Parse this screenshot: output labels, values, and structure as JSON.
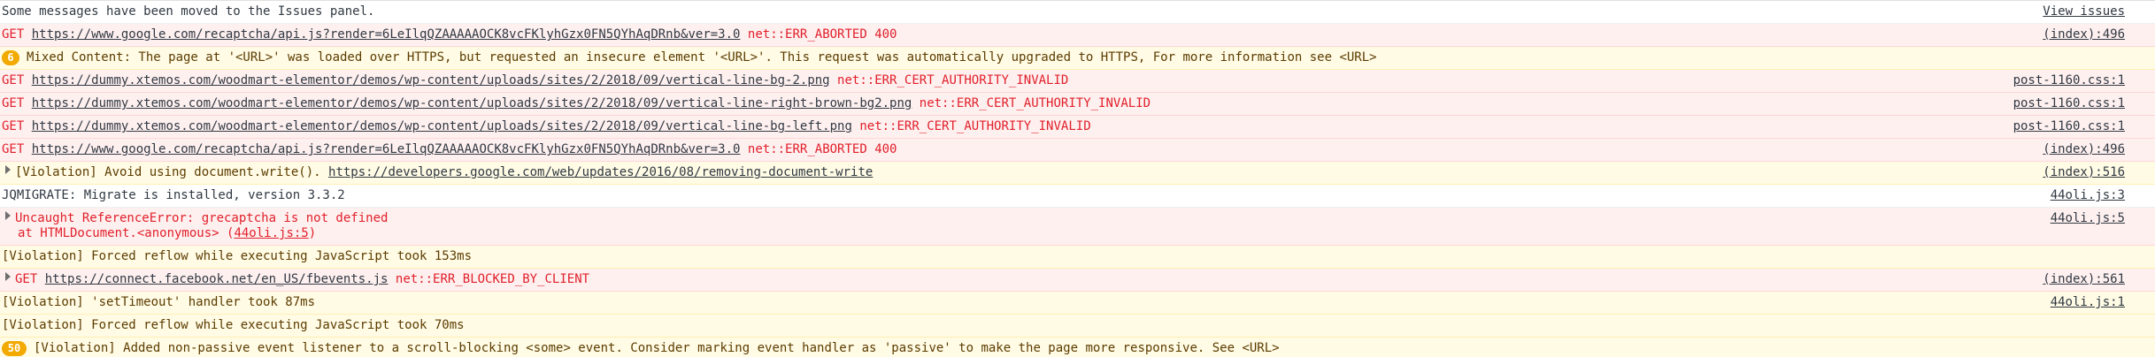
{
  "banner": {
    "text": "Some messages have been moved to the Issues panel.",
    "link": "View issues"
  },
  "rows": [
    {
      "method": "GET",
      "url": "https://www.google.com/recaptcha/api.js?render=6LeIlqQZAAAAAOCK8vcFKlyhGzx0FN5QYhAqDRnb&ver=3.0",
      "status": "net::ERR_ABORTED 400",
      "source": "(index):496"
    },
    {
      "badge": "6",
      "text": "Mixed Content: The page at '<URL>' was loaded over HTTPS, but requested an insecure element '<URL>'. This request was automatically upgraded to HTTPS, For more information see <URL>"
    },
    {
      "method": "GET",
      "url": "https://dummy.xtemos.com/woodmart-elementor/demos/wp-content/uploads/sites/2/2018/09/vertical-line-bg-2.png",
      "status": "net::ERR_CERT_AUTHORITY_INVALID",
      "source": "post-1160.css:1"
    },
    {
      "method": "GET",
      "url": "https://dummy.xtemos.com/woodmart-elementor/demos/wp-content/uploads/sites/2/2018/09/vertical-line-right-brown-bg2.png",
      "status": "net::ERR_CERT_AUTHORITY_INVALID",
      "source": "post-1160.css:1"
    },
    {
      "method": "GET",
      "url": "https://dummy.xtemos.com/woodmart-elementor/demos/wp-content/uploads/sites/2/2018/09/vertical-line-bg-left.png",
      "status": "net::ERR_CERT_AUTHORITY_INVALID",
      "source": "post-1160.css:1"
    },
    {
      "method": "GET",
      "url": "https://www.google.com/recaptcha/api.js?render=6LeIlqQZAAAAAOCK8vcFKlyhGzx0FN5QYhAqDRnb&ver=3.0",
      "status": "net::ERR_ABORTED 400",
      "source": "(index):496"
    },
    {
      "text": "[Violation] Avoid using document.write().",
      "url": "https://developers.google.com/web/updates/2016/08/removing-document-write",
      "source": "(index):516"
    },
    {
      "text": "JQMIGRATE: Migrate is installed, version 3.3.2",
      "source": "44oli.js:3"
    },
    {
      "text": "Uncaught ReferenceError: grecaptcha is not defined",
      "text2_prefix": "at HTMLDocument.<anonymous> (",
      "text2_link": "44oli.js:5",
      "text2_suffix": ")",
      "source": "44oli.js:5"
    },
    {
      "text": "[Violation] Forced reflow while executing JavaScript took 153ms"
    },
    {
      "method": "GET",
      "url": "https://connect.facebook.net/en_US/fbevents.js",
      "status": "net::ERR_BLOCKED_BY_CLIENT",
      "source": "(index):561"
    },
    {
      "text": "[Violation] 'setTimeout' handler took 87ms",
      "source": "44oli.js:1"
    },
    {
      "text": "[Violation] Forced reflow while executing JavaScript took 70ms"
    },
    {
      "badge": "50",
      "text": "[Violation] Added non-passive event listener to a scroll-blocking <some> event. Consider marking event handler as 'passive' to make the page more responsive. See <URL>"
    }
  ],
  "colors": {
    "error_bg": "#fff0f0",
    "error_text": "#e0202a",
    "warn_bg": "#fffbe5",
    "warn_text": "#5c3c00",
    "badge_bg": "#f2a900"
  }
}
